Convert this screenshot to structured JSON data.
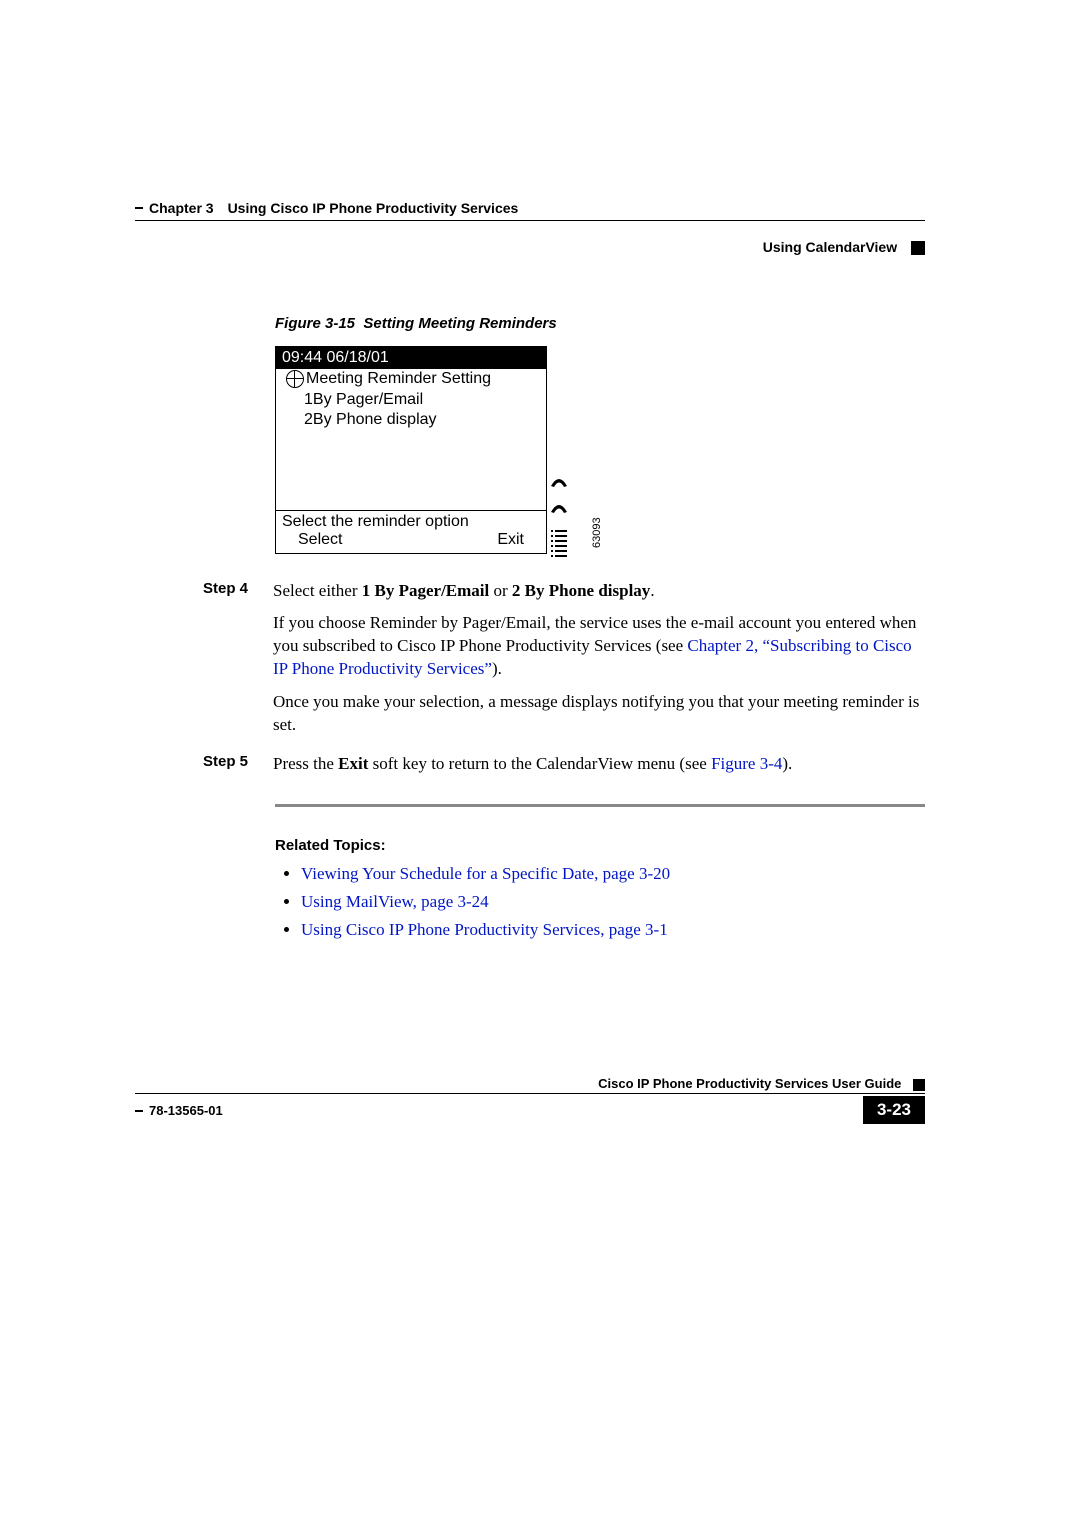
{
  "header": {
    "chapter": "Chapter 3 Using Cisco IP Phone Productivity Services",
    "section": "Using CalendarView"
  },
  "figure": {
    "label": "Figure 3-15",
    "title": "Setting Meeting Reminders",
    "image_number": "63093"
  },
  "phone": {
    "timestamp": "09:44 06/18/01",
    "screen_title": "Meeting Reminder Setting",
    "options": [
      "1By Pager/Email",
      "2By Phone display"
    ],
    "hint": "Select the reminder option",
    "softkeys": {
      "left": "Select",
      "right": "Exit"
    }
  },
  "steps": {
    "s4": {
      "label": "Step 4",
      "line1_a": "Select either ",
      "line1_b": "1 By Pager/Email",
      "line1_c": " or ",
      "line1_d": "2 By Phone display",
      "line1_e": ".",
      "para2": "If you choose Reminder by Pager/Email, the service uses the e-mail account you entered when you subscribed to Cisco IP Phone Productivity Services (see ",
      "para2_link": "Chapter 2, “Subscribing to Cisco IP Phone Productivity Services”",
      "para2_tail": ").",
      "para3": "Once you make your selection, a message displays notifying you that your meeting reminder is set."
    },
    "s5": {
      "label": "Step 5",
      "a": "Press the ",
      "b": "Exit",
      "c": " soft key to return to the CalendarView menu (see ",
      "link": "Figure 3-4",
      "tail": ")."
    }
  },
  "related": {
    "heading": "Related Topics:",
    "items": [
      "Viewing Your Schedule for a Specific Date, page 3-20",
      "Using MailView, page 3-24",
      "Using Cisco IP Phone Productivity Services, page 3-1"
    ]
  },
  "footer": {
    "guide": "Cisco IP Phone Productivity Services User Guide",
    "docnum": "78-13565-01",
    "pagenum": "3-23"
  }
}
